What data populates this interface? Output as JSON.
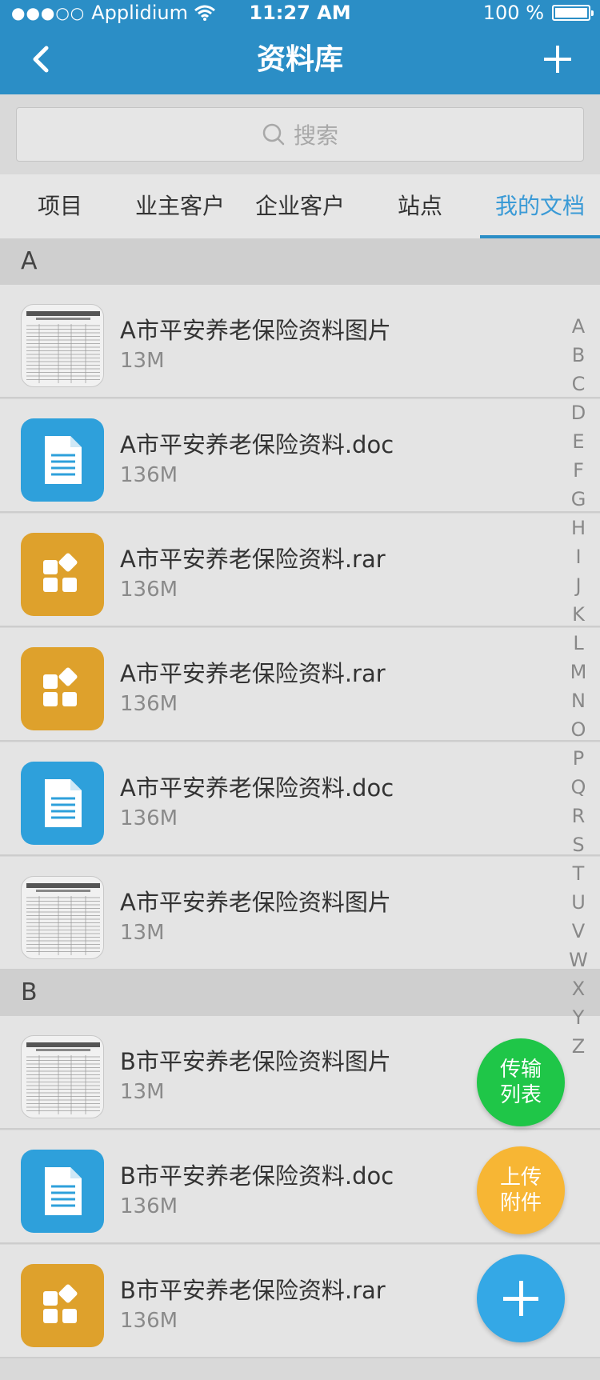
{
  "status_bar": {
    "carrier": "Applidium",
    "time": "11:27 AM",
    "battery": "100 %"
  },
  "nav": {
    "title": "资料库",
    "back_icon": "chevron-left-icon",
    "add_icon": "plus-icon"
  },
  "search": {
    "placeholder": "搜索"
  },
  "tabs": [
    {
      "label": "项目",
      "active": false
    },
    {
      "label": "业主客户",
      "active": false
    },
    {
      "label": "企业客户",
      "active": false
    },
    {
      "label": "站点",
      "active": false
    },
    {
      "label": "我的文档",
      "active": true
    }
  ],
  "sections": [
    {
      "letter": "A",
      "files": [
        {
          "name": "A市平安养老保险资料图片",
          "size": "13M",
          "type": "image"
        },
        {
          "name": "A市平安养老保险资料.doc",
          "size": "136M",
          "type": "doc"
        },
        {
          "name": "A市平安养老保险资料.rar",
          "size": "136M",
          "type": "rar"
        },
        {
          "name": "A市平安养老保险资料.rar",
          "size": "136M",
          "type": "rar"
        },
        {
          "name": "A市平安养老保险资料.doc",
          "size": "136M",
          "type": "doc"
        },
        {
          "name": "A市平安养老保险资料图片",
          "size": "13M",
          "type": "image"
        }
      ]
    },
    {
      "letter": "B",
      "files": [
        {
          "name": "B市平安养老保险资料图片",
          "size": "13M",
          "type": "image"
        },
        {
          "name": "B市平安养老保险资料.doc",
          "size": "136M",
          "type": "doc"
        },
        {
          "name": "B市平安养老保险资料.rar",
          "size": "136M",
          "type": "rar"
        }
      ]
    }
  ],
  "alphabet": [
    "A",
    "B",
    "C",
    "D",
    "E",
    "F",
    "G",
    "H",
    "I",
    "J",
    "K",
    "L",
    "M",
    "N",
    "O",
    "P",
    "Q",
    "R",
    "S",
    "T",
    "U",
    "V",
    "W",
    "X",
    "Y",
    "Z"
  ],
  "fabs": {
    "transfer_line1": "传输",
    "transfer_line2": "列表",
    "upload_line1": "上传",
    "upload_line2": "附件"
  },
  "colors": {
    "primary": "#2b8ec6",
    "doc": "#2ea0db",
    "rar": "#dea12c",
    "fab_green": "#1fc648",
    "fab_orange": "#f7b634",
    "fab_blue": "#34a8e6"
  }
}
